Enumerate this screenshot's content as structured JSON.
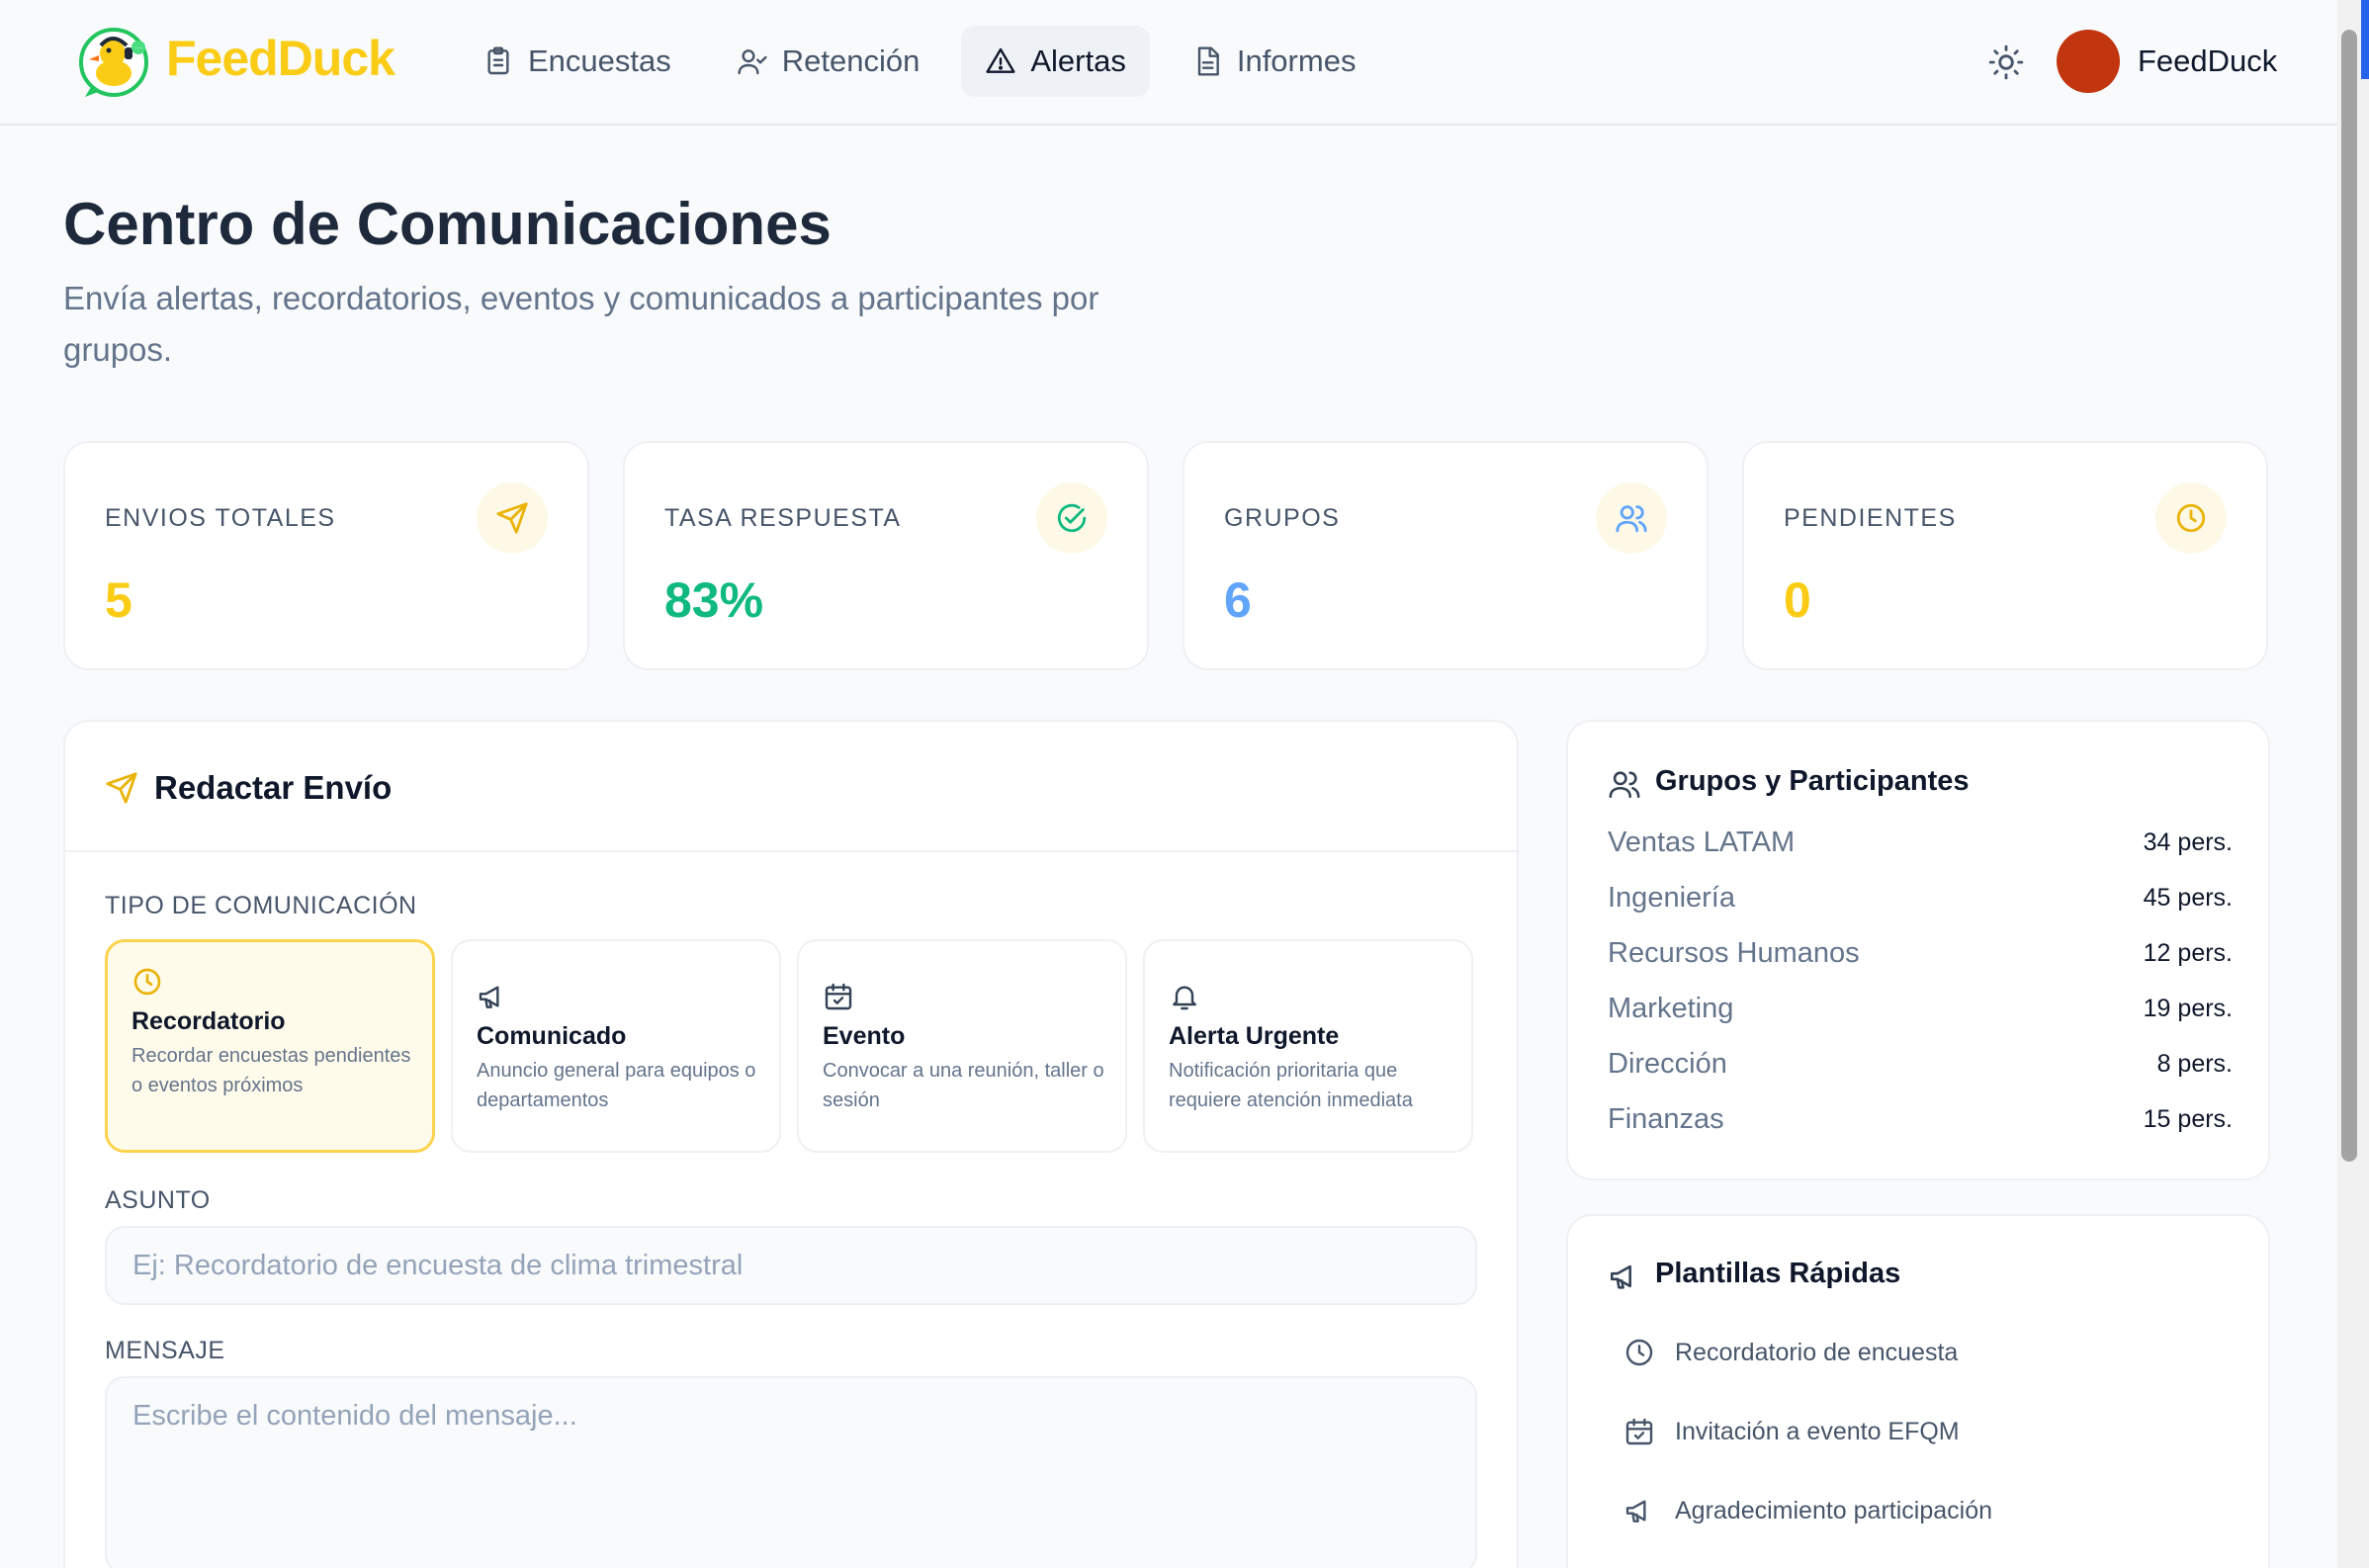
{
  "app": {
    "brand": "FeedDuck"
  },
  "nav": {
    "items": [
      {
        "label": "Encuestas",
        "icon": "clipboard-icon"
      },
      {
        "label": "Retención",
        "icon": "user-check-icon"
      },
      {
        "label": "Alertas",
        "icon": "warning-triangle-icon",
        "active": true
      },
      {
        "label": "Informes",
        "icon": "document-icon"
      }
    ]
  },
  "user": {
    "name": "FeedDuck",
    "avatar_color": "#c2360f"
  },
  "page": {
    "title": "Centro de Comunicaciones",
    "subtitle": "Envía alertas, recordatorios, eventos y comunicados a participantes por grupos."
  },
  "stats": [
    {
      "label": "ENVIOS TOTALES",
      "value": "5",
      "color": "#facc15",
      "icon": "send-icon"
    },
    {
      "label": "TASA RESPUESTA",
      "value": "83%",
      "color": "#10b981",
      "icon": "check-circle-icon"
    },
    {
      "label": "GRUPOS",
      "value": "6",
      "color": "#60a5fa",
      "icon": "users-icon"
    },
    {
      "label": "PENDIENTES",
      "value": "0",
      "color": "#facc15",
      "icon": "clock-icon"
    }
  ],
  "compose": {
    "title": "Redactar Envío",
    "type_label": "TIPO DE COMUNICACIÓN",
    "types": [
      {
        "title": "Recordatorio",
        "desc": "Recordar encuestas pendientes o eventos próximos",
        "icon": "clock-icon",
        "selected": true
      },
      {
        "title": "Comunicado",
        "desc": "Anuncio general para equipos o departamentos",
        "icon": "megaphone-icon"
      },
      {
        "title": "Evento",
        "desc": "Convocar a una reunión, taller o sesión",
        "icon": "calendar-icon"
      },
      {
        "title": "Alerta Urgente",
        "desc": "Notificación prioritaria que requiere atención inmediata",
        "icon": "bell-icon"
      }
    ],
    "subject_label": "ASUNTO",
    "subject_placeholder": "Ej: Recordatorio de encuesta de clima trimestral",
    "message_label": "MENSAJE",
    "message_placeholder": "Escribe el contenido del mensaje..."
  },
  "groups": {
    "title": "Grupos y Participantes",
    "items": [
      {
        "name": "Ventas LATAM",
        "count": "34 pers."
      },
      {
        "name": "Ingeniería",
        "count": "45 pers."
      },
      {
        "name": "Recursos Humanos",
        "count": "12 pers."
      },
      {
        "name": "Marketing",
        "count": "19 pers."
      },
      {
        "name": "Dirección",
        "count": "8 pers."
      },
      {
        "name": "Finanzas",
        "count": "15 pers."
      }
    ]
  },
  "templates": {
    "title": "Plantillas Rápidas",
    "items": [
      {
        "label": "Recordatorio de encuesta",
        "icon": "clock-icon"
      },
      {
        "label": "Invitación a evento EFQM",
        "icon": "calendar-icon"
      },
      {
        "label": "Agradecimiento participación",
        "icon": "megaphone-icon"
      }
    ]
  }
}
